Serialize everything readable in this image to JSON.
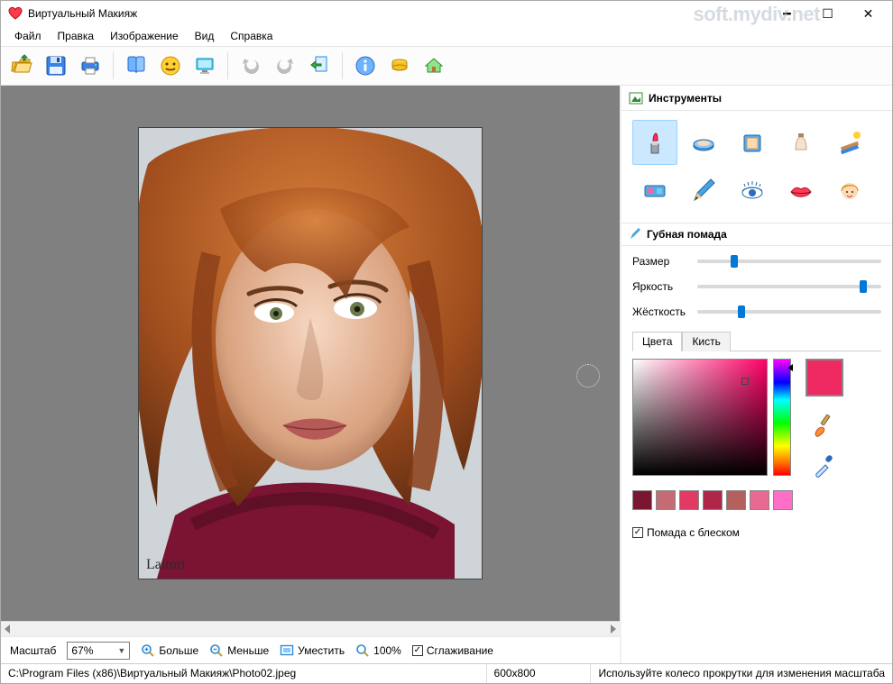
{
  "window": {
    "title": "Виртуальный Макияж",
    "watermark": "soft.mydiv.net"
  },
  "menu": {
    "items": [
      "Файл",
      "Правка",
      "Изображение",
      "Вид",
      "Справка"
    ]
  },
  "toolbar": {
    "open": "open",
    "save": "save",
    "print": "print",
    "album": "album",
    "effects": "effects",
    "monitor": "monitor",
    "undo": "undo",
    "redo": "redo",
    "export": "export",
    "info": "info",
    "coins": "coins",
    "home": "home"
  },
  "photo": {
    "signature": "Laitori"
  },
  "zoombar": {
    "scale_label": "Масштаб",
    "scale_value": "67%",
    "more": "Больше",
    "less": "Меньше",
    "fit": "Уместить",
    "hundred": "100%",
    "smoothing": "Сглаживание",
    "smoothing_checked": true
  },
  "status": {
    "path": "C:\\Program Files (x86)\\Виртуальный Макияж\\Photo02.jpeg",
    "dimensions": "600x800",
    "tip": "Используйте колесо прокрутки для изменения масштаба"
  },
  "panel": {
    "tools_title": "Инструменты",
    "tools": [
      "lipstick",
      "powder",
      "foundation",
      "concealer",
      "tanning",
      "eyeshadow",
      "pencil",
      "mascara",
      "lips-shape",
      "hair"
    ],
    "selected_tool_index": 0,
    "section_title": "Губная помада",
    "sliders": {
      "size": {
        "label": "Размер",
        "value": 18
      },
      "bright": {
        "label": "Яркость",
        "value": 88
      },
      "hard": {
        "label": "Жёсткость",
        "value": 22
      }
    },
    "tabs": {
      "colors": "Цвета",
      "brush": "Кисть",
      "active": 0
    },
    "swatch": "#ef2a62",
    "presets": [
      "#7a1630",
      "#c46b74",
      "#e23a63",
      "#b0254a",
      "#b4605c",
      "#e86a92",
      "#ff6ec7"
    ],
    "gloss": {
      "label": "Помада с блеском",
      "checked": true
    }
  }
}
